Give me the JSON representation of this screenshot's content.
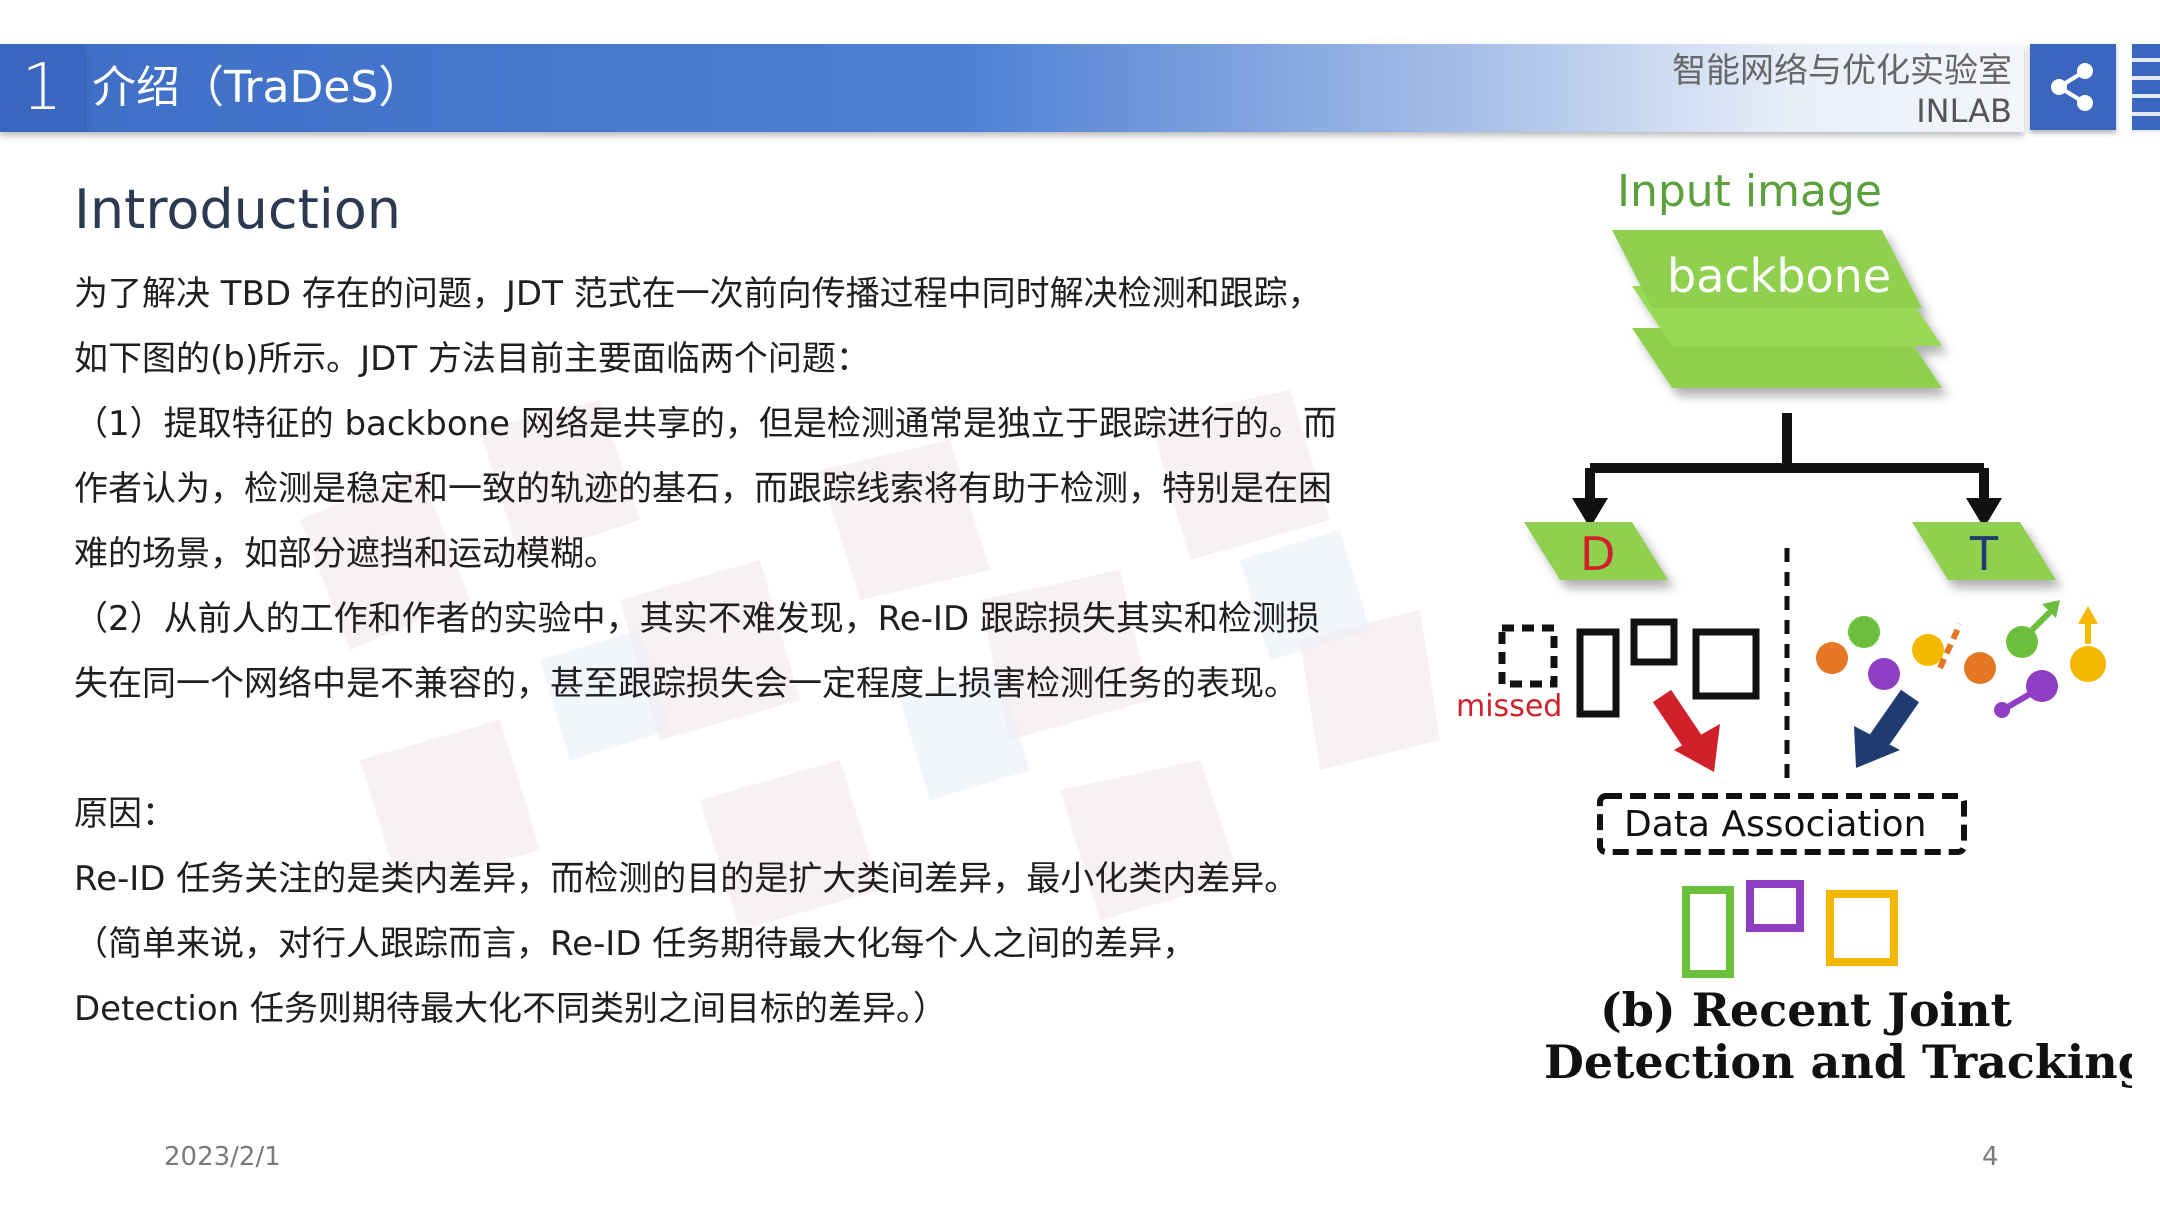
{
  "header": {
    "section_number": "1",
    "title": "介绍（TraDeS）",
    "lab_name_cn": "智能网络与优化实验室",
    "lab_name_en": "INLAB"
  },
  "content": {
    "heading": "Introduction",
    "paragraphs": [
      "为了解决 TBD 存在的问题，JDT 范式在一次前向传播过程中同时解决检测和跟踪，",
      "如下图的(b)所示。JDT 方法目前主要面临两个问题：",
      "（1）提取特征的 backbone 网络是共享的，但是检测通常是独立于跟踪进行的。而",
      "作者认为，检测是稳定和一致的轨迹的基石，而跟踪线索将有助于检测，特别是在困",
      "难的场景，如部分遮挡和运动模糊。",
      "（2）从前人的工作和作者的实验中，其实不难发现，Re-ID 跟踪损失其实和检测损",
      "失在同一个网络中是不兼容的，甚至跟踪损失会一定程度上损害检测任务的表现。"
    ],
    "reason_label": "原因：",
    "reason_lines": [
      "Re-ID 任务关注的是类内差异，而检测的目的是扩大类间差异，最小化类内差异。",
      "（简单来说，对行人跟踪而言，Re-ID 任务期待最大化每个人之间的差异，",
      "Detection 任务则期待最大化不同类别之间目标的差异。）"
    ]
  },
  "figure": {
    "input_label": "Input image",
    "backbone_label": "backbone",
    "d_label": "D",
    "t_label": "T",
    "missed_label": "missed",
    "association_label": "Data Association",
    "caption_line1": "(b) Recent Joint",
    "caption_line2": "Detection and Tracking",
    "colors": {
      "layer_green": "#8fd14f",
      "arrow_red": "#d0202a",
      "arrow_navy": "#1f3b6f",
      "obj_purple": "#8e3fc4",
      "obj_orange": "#e67825",
      "obj_green": "#6cbf3c",
      "obj_yellow": "#f5b800"
    }
  },
  "footer": {
    "date": "2023/2/1",
    "page": "4"
  }
}
